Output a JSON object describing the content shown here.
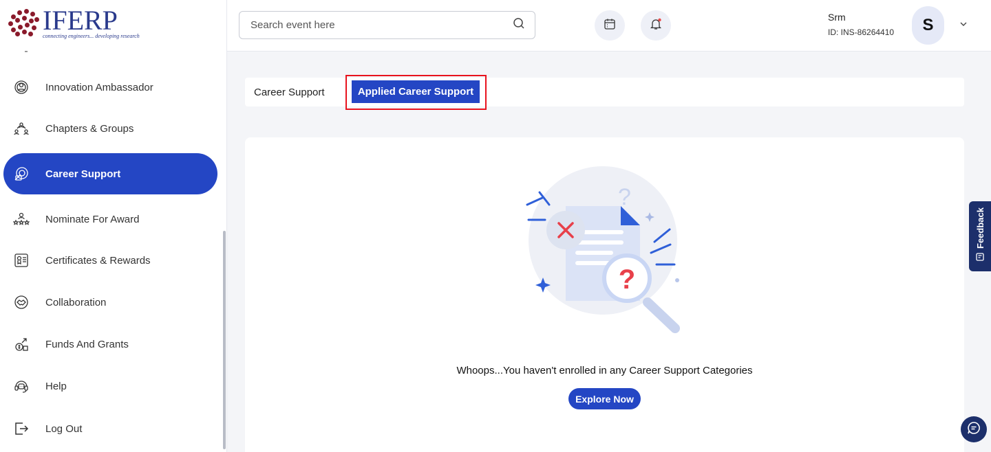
{
  "brand": {
    "name": "IFERP",
    "tagline": "connecting engineers... developing research"
  },
  "sidebar": {
    "items": [
      {
        "label": "Innovation Ambassador",
        "icon": "ambassador-icon",
        "active": false
      },
      {
        "label": "Chapters & Groups",
        "icon": "groups-icon",
        "active": false
      },
      {
        "label": "Career Support",
        "icon": "career-icon",
        "active": true
      },
      {
        "label": "Nominate For Award",
        "icon": "award-icon",
        "active": false
      },
      {
        "label": "Certificates & Rewards",
        "icon": "certificate-icon",
        "active": false
      },
      {
        "label": "Collaboration",
        "icon": "handshake-icon",
        "active": false
      },
      {
        "label": "Funds And Grants",
        "icon": "funds-icon",
        "active": false
      },
      {
        "label": "Help",
        "icon": "headset-icon",
        "active": false
      },
      {
        "label": "Log Out",
        "icon": "logout-icon",
        "active": false
      }
    ]
  },
  "header": {
    "search_placeholder": "Search event here",
    "user_name": "Srm",
    "user_id": "ID: INS-86264410",
    "avatar_initial": "S"
  },
  "tabs": {
    "career_support": "Career Support",
    "applied_career_support": "Applied Career Support"
  },
  "empty_state": {
    "message": "Whoops...You haven't enrolled in any Career Support Categories",
    "button": "Explore Now"
  },
  "feedback": {
    "label": "Feedback"
  },
  "colors": {
    "primary": "#2446c4",
    "navy": "#1c2f6b",
    "highlight": "#e8121d"
  }
}
